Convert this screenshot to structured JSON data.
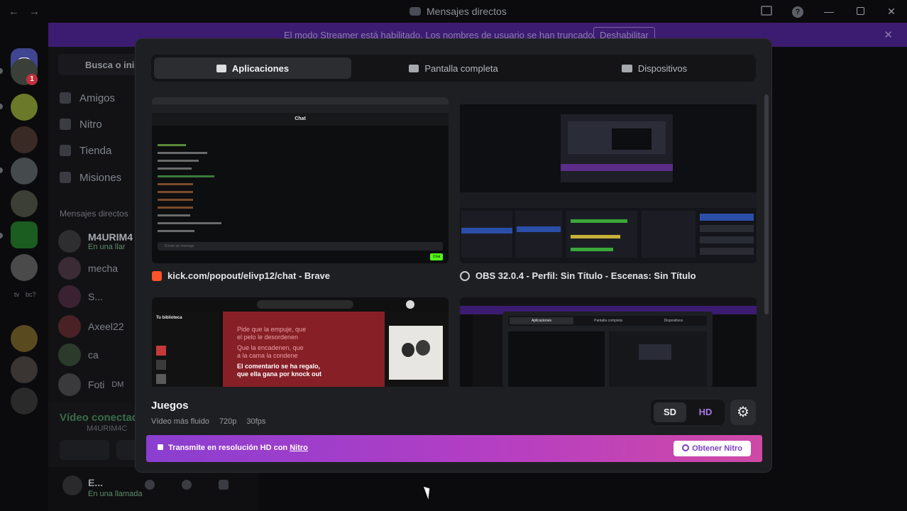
{
  "window": {
    "title": "Mensajes directos",
    "back_glyph": "←",
    "forward_glyph": "→",
    "minimize_glyph": "—",
    "close_glyph": "✕",
    "help_glyph": "?"
  },
  "streamer_banner": {
    "text": "El modo Streamer está habilitado. Los nombres de usuario se han truncado.",
    "button": "Deshabilitar",
    "close_glyph": "✕"
  },
  "rail": {
    "badge": "1",
    "texts": [
      "tv",
      "bc?"
    ]
  },
  "dm_column": {
    "search_placeholder": "Busca o inici",
    "nav": [
      "Amigos",
      "Nitro",
      "Tienda",
      "Misiones"
    ],
    "section_title": "Mensajes directos",
    "dms": [
      {
        "name": "M4URIM4",
        "status": "En una llar"
      },
      {
        "name": "mecha",
        "status": ""
      },
      {
        "name": "S...",
        "status": ""
      },
      {
        "name": "Axeel22",
        "status": ""
      },
      {
        "name": "ca",
        "status": ""
      },
      {
        "name": "Foti",
        "status": "DM"
      }
    ],
    "voice_status": "Vídeo conectado",
    "voice_sub": "M4URIM4C",
    "user_name": "E...",
    "user_status": "En una llamada"
  },
  "modal": {
    "tabs": [
      {
        "label": "Aplicaciones",
        "icon": "app-window-icon"
      },
      {
        "label": "Pantalla completa",
        "icon": "monitor-icon"
      },
      {
        "label": "Dispositivos",
        "icon": "camera-icon"
      }
    ],
    "sources": [
      {
        "caption": "kick.com/popout/elivp12/chat - Brave",
        "chat_title": "Chat",
        "chat_input": "Enviar un mensaje",
        "chat_button": "Chat"
      },
      {
        "caption": "OBS 32.0.4 - Perfil: Sin Título - Escenas: Sin Título"
      },
      {
        "lyrics": [
          "Pide que la empuje, que",
          "el pelo le desordenen",
          "Que la encadenen, que",
          "a la cama la condene",
          "El comentario se ha regalo,",
          "que ella gana por knock out"
        ],
        "sidebar_title": "Tu biblioteca"
      },
      {
        "thumb_tabs": [
          "Aplicaciones",
          "Pantalla completa",
          "Dispositivos"
        ]
      }
    ],
    "quality_title": "Juegos",
    "quality_specs": [
      "Vídeo más fluido",
      "720p",
      "30fps"
    ],
    "sd_label": "SD",
    "hd_label": "HD",
    "gear_glyph": "⚙",
    "nitro_text": "Transmite en resolución HD con",
    "nitro_link": "Nitro",
    "nitro_button": "Obtener Nitro"
  },
  "colors": {
    "accent": "#5865f2",
    "banner": "#3c1c70",
    "nitro_start": "#8a3ed0",
    "nitro_end": "#cf49a6",
    "hd": "#a878e6"
  }
}
